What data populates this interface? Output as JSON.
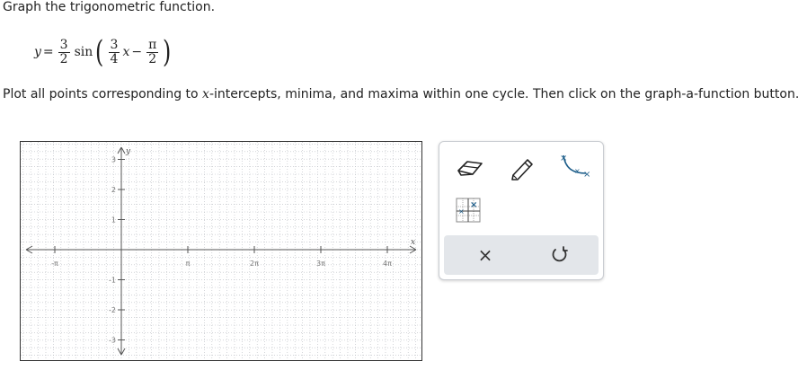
{
  "instructions": {
    "heading": "Graph the trigonometric function.",
    "plot_prefix": "Plot all points corresponding to ",
    "plot_var": "x",
    "plot_suffix": "-intercepts, minima, and maxima within one cycle. Then click on the graph-a-function button."
  },
  "equation": {
    "lhs": "y",
    "equals": "=",
    "coef_num": "3",
    "coef_den": "2",
    "func": "sin",
    "inner_num": "3",
    "inner_den": "4",
    "var": "x",
    "minus": "−",
    "shift_num": "π",
    "shift_den": "2"
  },
  "graph": {
    "x_axis_label": "x",
    "y_axis_label": "y",
    "x_ticks": [
      {
        "value": -1,
        "label": "-π"
      },
      {
        "value": 1,
        "label": "π"
      },
      {
        "value": 2,
        "label": "2π"
      },
      {
        "value": 3,
        "label": "3π"
      },
      {
        "value": 4,
        "label": "4π"
      }
    ],
    "y_ticks": [
      {
        "value": -3,
        "label": "-3"
      },
      {
        "value": -2,
        "label": "-2"
      },
      {
        "value": -1,
        "label": "-1"
      },
      {
        "value": 1,
        "label": "1"
      },
      {
        "value": 2,
        "label": "2"
      },
      {
        "value": 3,
        "label": "3"
      }
    ]
  },
  "tools": {
    "eraser": "eraser-icon",
    "pencil": "pencil-icon",
    "curve": "curve-tool-icon",
    "graph_function": "graph-function-icon",
    "clear": "×",
    "undo": "undo-icon"
  },
  "colors": {
    "accent": "#1f5f8b",
    "action_bar": "#e3e6ea"
  }
}
